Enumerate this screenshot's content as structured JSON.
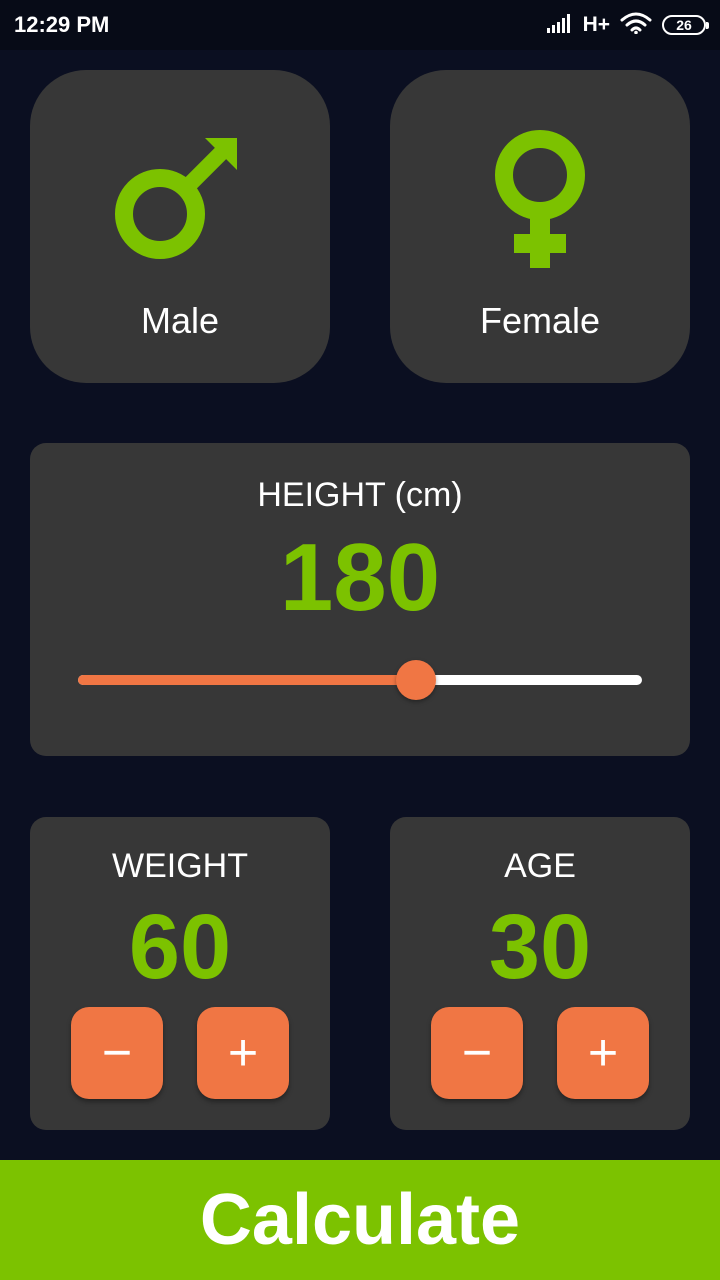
{
  "status_bar": {
    "time": "12:29 PM",
    "network": "H+",
    "battery": "26"
  },
  "gender": {
    "male_label": "Male",
    "female_label": "Female"
  },
  "height": {
    "title": "HEIGHT (cm)",
    "value": "180",
    "slider_fraction": 0.6
  },
  "weight": {
    "title": "WEIGHT",
    "value": "60",
    "decrement": "−",
    "increment": "+"
  },
  "age": {
    "title": "AGE",
    "value": "30",
    "decrement": "−",
    "increment": "+"
  },
  "calculate_label": "Calculate",
  "colors": {
    "background": "#0b0f21",
    "card": "#373737",
    "accent_green": "#7cc200",
    "accent_orange": "#f07644"
  },
  "icons": [
    "signal-icon",
    "wifi-icon",
    "battery-icon",
    "male-symbol-icon",
    "female-symbol-icon"
  ]
}
